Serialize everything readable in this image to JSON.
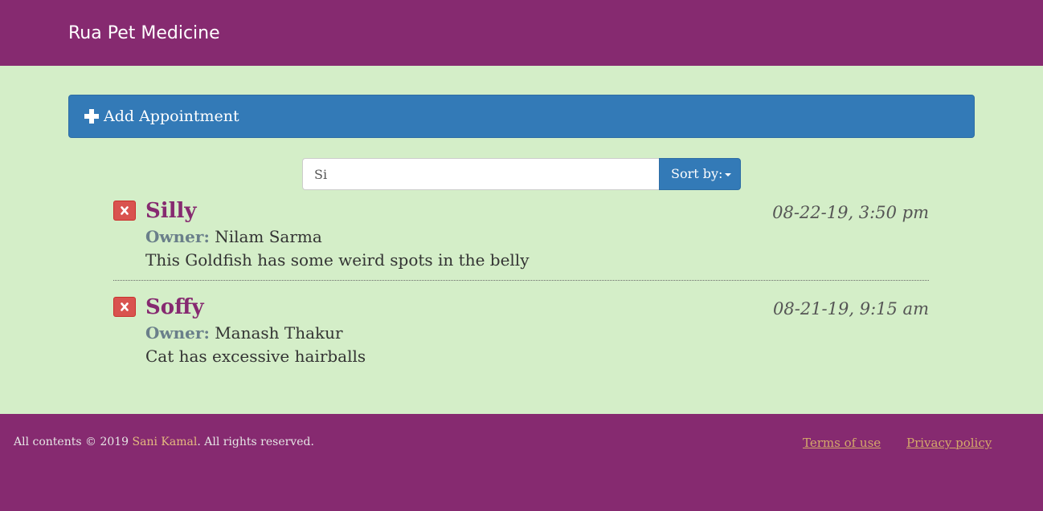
{
  "navbar": {
    "brand": "Rua Pet Medicine"
  },
  "add_panel": {
    "label": "Add Appointment",
    "icon": "plus-icon"
  },
  "search": {
    "value": "Si",
    "sort_label": "Sort by:"
  },
  "appointments": [
    {
      "pet_name": "Silly",
      "date": "08-22-19, 3:50 pm",
      "owner_label": "Owner:",
      "owner": "Nilam Sarma",
      "notes": "This Goldfish has some weird spots in the belly"
    },
    {
      "pet_name": "Soffy",
      "date": "08-21-19, 9:15 am",
      "owner_label": "Owner:",
      "owner": "Manash Thakur",
      "notes": "Cat has excessive hairballs"
    }
  ],
  "footer": {
    "copyright_prefix": "All contents © 2019 ",
    "author": "Sani Kamal",
    "copyright_suffix": ". All rights reserved.",
    "terms": "Terms of use",
    "privacy": "Privacy policy"
  },
  "colors": {
    "navbar": "#862a70",
    "background": "#d4eec8",
    "primary": "#337ab7",
    "danger": "#d9534f",
    "pet_name": "#862a70"
  }
}
